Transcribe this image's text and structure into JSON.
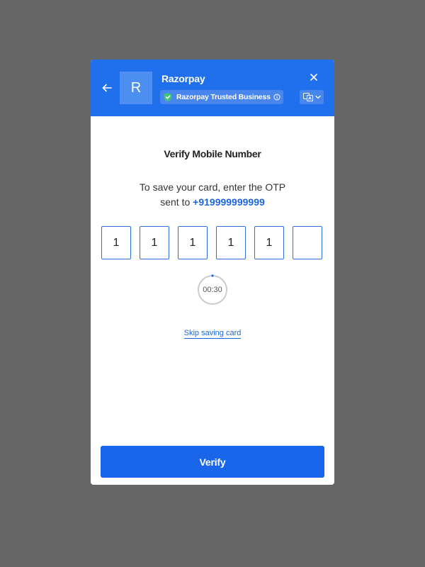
{
  "header": {
    "logo_letter": "R",
    "merchant_name": "Razorpay",
    "trust_badge_label": "Razorpay Trusted Business",
    "accent_color": "#2070ee"
  },
  "icons": {
    "back": "arrow-left-icon",
    "close": "close-icon",
    "shield": "shield-check-icon",
    "info": "info-icon",
    "language": "translate-icon",
    "chevron": "chevron-down-icon"
  },
  "main": {
    "title": "Verify Mobile Number",
    "description_line1": "To save your card, enter the OTP",
    "description_prefix": "sent to ",
    "phone_number": "+919999999999",
    "otp_digits": [
      "1",
      "1",
      "1",
      "1",
      "1",
      ""
    ],
    "timer": "00:30",
    "skip_label": "Skip saving card"
  },
  "footer": {
    "verify_label": "Verify"
  }
}
